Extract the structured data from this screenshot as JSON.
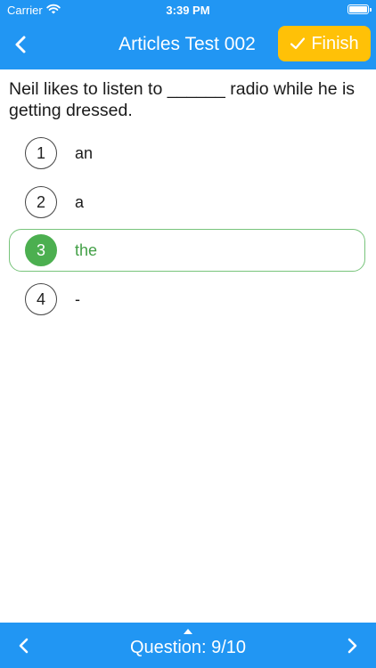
{
  "status_bar": {
    "carrier": "Carrier",
    "time": "3:39 PM"
  },
  "header": {
    "title": "Articles Test 002",
    "finish_label": "Finish"
  },
  "question": {
    "text": "Neil likes to listen to ______ radio while he is getting dressed."
  },
  "options": [
    {
      "number": "1",
      "label": "an"
    },
    {
      "number": "2",
      "label": "a"
    },
    {
      "number": "3",
      "label": "the"
    },
    {
      "number": "4",
      "label": "-"
    }
  ],
  "selected_option": "3",
  "footer": {
    "counter": "Question: 9/10"
  },
  "colors": {
    "primary": "#2196f3",
    "accent": "#ffc107",
    "selected": "#4caf50"
  },
  "icons": [
    "wifi-icon",
    "battery-icon",
    "back-chevron-icon",
    "checkmark-icon",
    "chevron-up-icon",
    "chevron-left-icon",
    "chevron-right-icon"
  ]
}
